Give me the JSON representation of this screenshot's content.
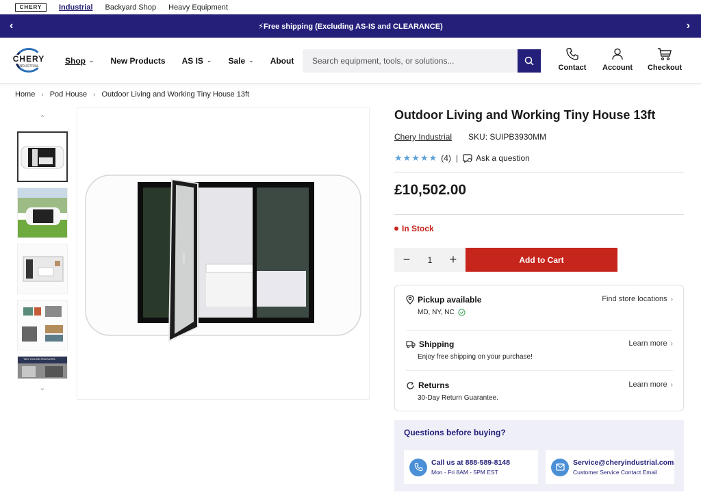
{
  "brandbar": {
    "logo_text": "CHERY",
    "links": [
      "Industrial",
      "Backyard Shop",
      "Heavy Equipment"
    ]
  },
  "announcement": {
    "text": "⚡Free shipping (Excluding AS-IS and CLEARANCE)",
    "prev_icon": "chevron-left-icon",
    "next_icon": "chevron-right-icon"
  },
  "header": {
    "logo_text": "CHERY",
    "logo_sub": "INDUSTRIAL",
    "nav": [
      {
        "label": "Shop",
        "has_dropdown": true
      },
      {
        "label": "New Products",
        "has_dropdown": false
      },
      {
        "label": "AS IS",
        "has_dropdown": true
      },
      {
        "label": "Sale",
        "has_dropdown": true
      },
      {
        "label": "About",
        "has_dropdown": false
      }
    ],
    "search_placeholder": "Search equipment, tools, or solutions...",
    "contact_label": "Contact",
    "account_label": "Account",
    "checkout_label": "Checkout"
  },
  "breadcrumb": [
    "Home",
    "Pod House",
    "Outdoor Living and Working Tiny House 13ft"
  ],
  "gallery": {
    "thumbnail_count": 5,
    "selected_index": 0,
    "thumb5_caption": "TINY HOUSE FEATURES"
  },
  "product": {
    "title": "Outdoor Living and Working Tiny House 13ft",
    "vendor": "Chery Industrial",
    "sku": "SKU: SUIPB3930MM",
    "stars": 5,
    "review_count": "(4)",
    "ask_question": "Ask a question",
    "price": "£10,502.00",
    "stock": "In Stock",
    "quantity": "1",
    "add_to_cart": "Add to Cart"
  },
  "info": {
    "pickup": {
      "title": "Pickup available",
      "detail": "MD, NY, NC",
      "link": "Find store locations"
    },
    "shipping": {
      "title": "Shipping",
      "detail": "Enjoy free shipping on your purchase!",
      "link": "Learn more"
    },
    "returns": {
      "title": "Returns",
      "detail": "30-Day Return Guarantee.",
      "link": "Learn more"
    }
  },
  "questions": {
    "title": "Questions before buying?",
    "call_title": "Call us at 888-589-8148",
    "call_sub": "Mon - Fri 8AM - 5PM EST",
    "email_title": "Service@cheryindustrial.com",
    "email_sub": "Customer Service Contact Email"
  },
  "colors": {
    "brand_navy": "#24207a",
    "cta_red": "#c6251c",
    "star_blue": "#5aa0d8",
    "contact_circle": "#4b8fd6"
  }
}
